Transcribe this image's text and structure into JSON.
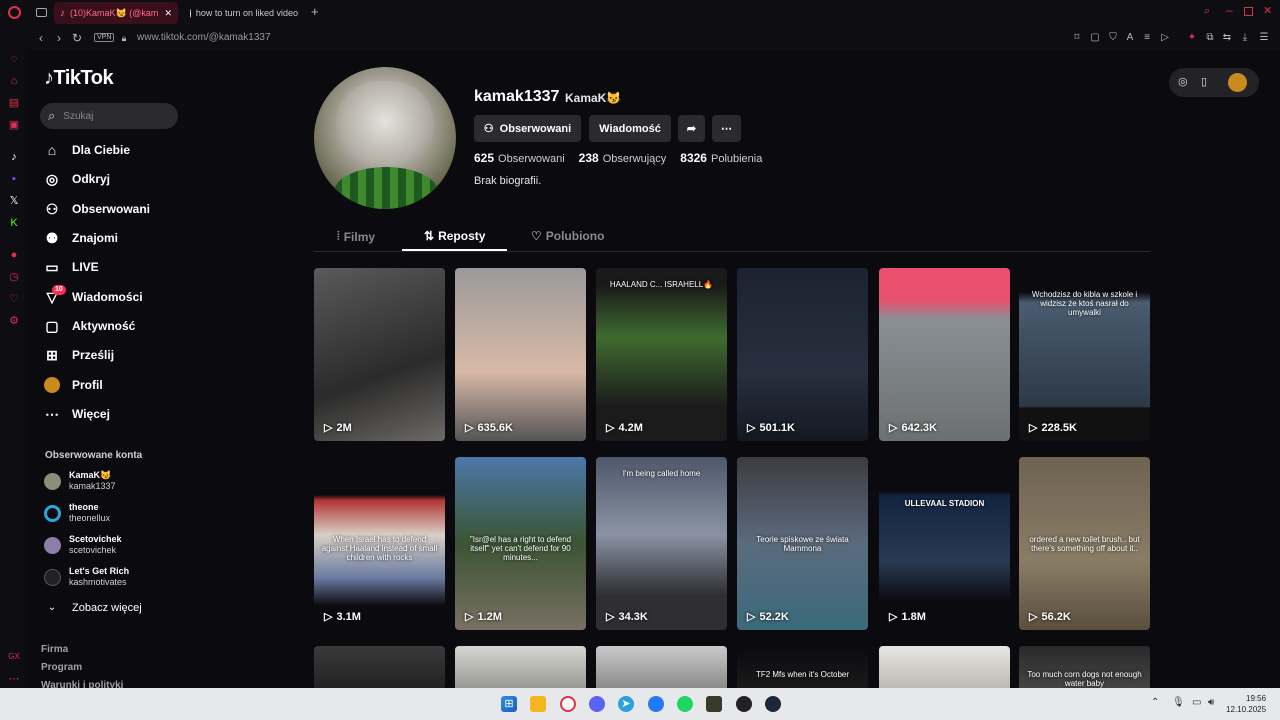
{
  "browser": {
    "tabs": [
      {
        "label": "(10)KamaK😼 (@kam",
        "active": true
      },
      {
        "label": "how to turn on liked video",
        "active": false
      }
    ],
    "vpn_label": "VPN",
    "url": "www.tiktok.com/@kamak1337"
  },
  "nav": {
    "logo": "TikTok",
    "search_placeholder": "Szukaj",
    "items": [
      {
        "label": "Dla Ciebie",
        "icon": "home-icon"
      },
      {
        "label": "Odkryj",
        "icon": "compass-icon"
      },
      {
        "label": "Obserwowani",
        "icon": "following-icon"
      },
      {
        "label": "Znajomi",
        "icon": "friends-icon"
      },
      {
        "label": "LIVE",
        "icon": "live-icon"
      },
      {
        "label": "Wiadomości",
        "icon": "messages-icon",
        "badge": "10"
      },
      {
        "label": "Aktywność",
        "icon": "activity-icon"
      },
      {
        "label": "Prześlij",
        "icon": "upload-icon"
      },
      {
        "label": "Profil",
        "icon": "profile-icon"
      },
      {
        "label": "Więcej",
        "icon": "more-icon"
      }
    ],
    "followed_title": "Obserwowane konta",
    "accounts": [
      {
        "name": "KamaK😼",
        "handle": "kamak1337",
        "color": "#8a8f7a"
      },
      {
        "name": "theone",
        "handle": "theonellux",
        "color": "#2aa7d9"
      },
      {
        "name": "Scetovichek",
        "handle": "scetovichek",
        "color": "#8b7ea8"
      },
      {
        "name": "Let's Get Rich",
        "handle": "kashmotivates",
        "color": "#222"
      }
    ],
    "see_more": "Zobacz więcej",
    "footer": [
      "Firma",
      "Program",
      "Warunki i polityki"
    ]
  },
  "profile": {
    "username": "kamak1337",
    "nickname": "KamaK😼",
    "follow_button": "Obserwowani",
    "message_button": "Wiadomość",
    "stats": [
      {
        "value": "625",
        "label": "Obserwowani"
      },
      {
        "value": "238",
        "label": "Obserwujący"
      },
      {
        "value": "8326",
        "label": "Polubienia"
      }
    ],
    "bio": "Brak biografii."
  },
  "tabs": [
    {
      "label": "Filmy",
      "active": false
    },
    {
      "label": "Reposty",
      "active": true
    },
    {
      "label": "Polubiono",
      "active": false
    }
  ],
  "videos": [
    {
      "views": "2M",
      "bg": "linear-gradient(160deg,#5a5a5a,#2b2b2b 60%,#6d6a66)",
      "caption": ""
    },
    {
      "views": "635.6K",
      "bg": "linear-gradient(180deg,#9a9a9a,#d8b9a6 60%,#555)",
      "caption": ""
    },
    {
      "views": "4.2M",
      "bg": "linear-gradient(180deg,#1a1a1a 10%,#3f6b2f 40%,#1b1b1b 80%)",
      "caption": "HAALAND C... ISRAHELL🔥"
    },
    {
      "views": "501.1K",
      "bg": "linear-gradient(180deg,#1c2230,#27303f 60%,#141820)",
      "caption": ""
    },
    {
      "views": "642.3K",
      "bg": "linear-gradient(180deg,#e9506d 0%,#e9506d 18%,#8a8f95 30%,#6c7070)",
      "caption": ""
    },
    {
      "views": "228.5K",
      "bg": "linear-gradient(180deg,#0b0b0f 14%,#4a5c70 20%,#2d3945 80%,#111 81%)",
      "caption": "Wchodzisz do kibla w szkole i widzisz że ktoś nasrał do umywalki"
    },
    {
      "views": "3.1M",
      "bg": "linear-gradient(180deg,#0b0b0f 22%,#b23434 25%,#d8d0c6 45%,#6a7aa0 70%,#0b0b0f 86%)",
      "caption": "When Israel has to defend against Haaland instead of small children with rocks"
    },
    {
      "views": "1.2M",
      "bg": "linear-gradient(180deg,#4c78a8,#3b5534 50%,#7a7064)",
      "caption": "\"Isr@el has a right to defend itself\" yet can't defend for 90 minutes..."
    },
    {
      "views": "34.3K",
      "bg": "linear-gradient(180deg,#4f586b,#8a93a3 45%,#2e2e33 80%)",
      "caption": "I'm being called home"
    },
    {
      "views": "52.2K",
      "bg": "linear-gradient(180deg,#3c3c40,#5b6b7e 50%,#3a6a7a)",
      "caption": "Teorie spiskowe ze świata Mammona"
    },
    {
      "views": "1.8M",
      "bg": "linear-gradient(180deg,#0b0b0f 20%,#122340 22%,#2a3a55 60%,#0b0b0f 83%)",
      "caption": "ULLEVAAL STADION"
    },
    {
      "views": "56.2K",
      "bg": "linear-gradient(180deg,#6e6352,#8a7d66 60%,#5a4e3e)",
      "caption": "ordered a new toilet brush.. but there's something off about it.."
    },
    {
      "views": "",
      "bg": "linear-gradient(180deg,#3a3a3a,#222)",
      "caption": ""
    },
    {
      "views": "",
      "bg": "linear-gradient(180deg,#d6d6d2,#9a9a94)",
      "caption": ""
    },
    {
      "views": "",
      "bg": "linear-gradient(180deg,#c9c9c9,#8a8a8a)",
      "caption": ""
    },
    {
      "views": "",
      "bg": "linear-gradient(180deg,#0b0b0f,#1a1a1a)",
      "caption": "TF2 Mfs when it's October"
    },
    {
      "views": "",
      "bg": "linear-gradient(180deg,#e8e6e2,#bdbab4)",
      "caption": ""
    },
    {
      "views": "",
      "bg": "linear-gradient(180deg,#2a2a2a,#444)",
      "caption": "Too much corn dogs not enough water baby"
    }
  ],
  "system": {
    "time": "19:56",
    "date": "12.10.2025"
  },
  "colors": {
    "accent": "#fe2c55",
    "opera_red": "#e0304f"
  }
}
